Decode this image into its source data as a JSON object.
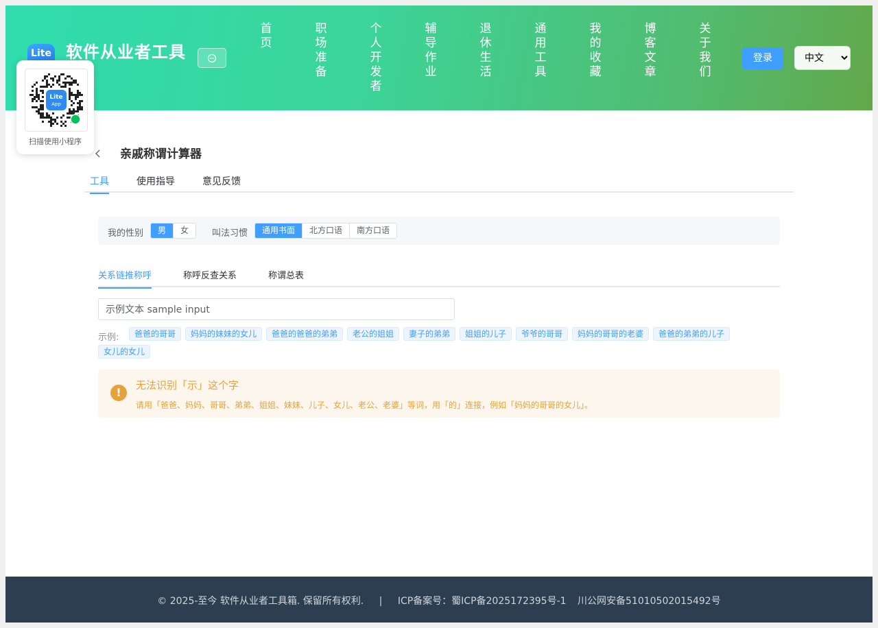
{
  "header": {
    "logo_text": "Lite",
    "site_title": "软件从业者工具",
    "nav": [
      "首页",
      "职场准备",
      "个人开发者",
      "辅导作业",
      "退休生活",
      "通用工具",
      "我的收藏",
      "博客文章",
      "关于我们"
    ],
    "login_label": "登录",
    "language": {
      "selected": "中文"
    }
  },
  "qr": {
    "caption": "扫描使用小程序",
    "badge_top": "Lite",
    "badge_bottom": "App"
  },
  "tool": {
    "title": "亲戚称谓计算器",
    "tabs": [
      "工具",
      "使用指导",
      "意见反馈"
    ],
    "active_tab": 0
  },
  "options": {
    "gender_label": "我的性别",
    "gender": [
      "男",
      "女"
    ],
    "gender_selected": 0,
    "habit_label": "叫法习惯",
    "habit": [
      "通用书面",
      "北方口语",
      "南方口语"
    ],
    "habit_selected": 0
  },
  "sub_tabs": [
    "关系链推称呼",
    "称呼反查关系",
    "称谓总表"
  ],
  "sub_tab_active": 0,
  "query": {
    "value": "示例文本 sample input"
  },
  "examples": {
    "label": "示例:",
    "items": [
      "爸爸的哥哥",
      "妈妈的妹妹的女儿",
      "爸爸的爸爸的弟弟",
      "老公的姐姐",
      "妻子的弟弟",
      "姐姐的儿子",
      "爷爷的哥哥",
      "妈妈的哥哥的老婆",
      "爸爸的弟弟的儿子",
      "女儿的女儿"
    ]
  },
  "alert": {
    "icon": "!",
    "title": "无法识别「示」这个字",
    "description": "请用「爸爸、妈妈、哥哥、弟弟、姐姐、妹妹、儿子、女儿、老公、老婆」等词，用「的」连接，例如「妈妈的哥哥的女儿」。"
  },
  "footer": {
    "copyright": "© 2025-至今 软件从业者工具箱. 保留所有权利.",
    "separator": "|",
    "icp": "ICP备案号：蜀ICP备2025172395号-1",
    "police": "川公网安备51010502015492号"
  },
  "colors": {
    "primary": "#409eff",
    "warning": "#e6a23c",
    "footer_bg": "#2c3e50"
  }
}
